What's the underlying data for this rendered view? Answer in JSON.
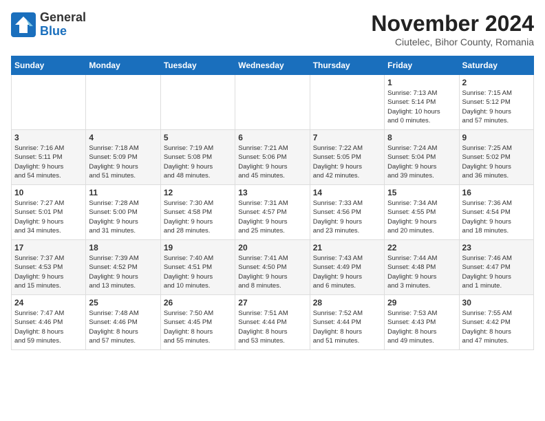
{
  "header": {
    "logo_line1": "General",
    "logo_line2": "Blue",
    "title": "November 2024",
    "subtitle": "Ciutelec, Bihor County, Romania"
  },
  "weekdays": [
    "Sunday",
    "Monday",
    "Tuesday",
    "Wednesday",
    "Thursday",
    "Friday",
    "Saturday"
  ],
  "weeks": [
    [
      {
        "day": "",
        "info": ""
      },
      {
        "day": "",
        "info": ""
      },
      {
        "day": "",
        "info": ""
      },
      {
        "day": "",
        "info": ""
      },
      {
        "day": "",
        "info": ""
      },
      {
        "day": "1",
        "info": "Sunrise: 7:13 AM\nSunset: 5:14 PM\nDaylight: 10 hours\nand 0 minutes."
      },
      {
        "day": "2",
        "info": "Sunrise: 7:15 AM\nSunset: 5:12 PM\nDaylight: 9 hours\nand 57 minutes."
      }
    ],
    [
      {
        "day": "3",
        "info": "Sunrise: 7:16 AM\nSunset: 5:11 PM\nDaylight: 9 hours\nand 54 minutes."
      },
      {
        "day": "4",
        "info": "Sunrise: 7:18 AM\nSunset: 5:09 PM\nDaylight: 9 hours\nand 51 minutes."
      },
      {
        "day": "5",
        "info": "Sunrise: 7:19 AM\nSunset: 5:08 PM\nDaylight: 9 hours\nand 48 minutes."
      },
      {
        "day": "6",
        "info": "Sunrise: 7:21 AM\nSunset: 5:06 PM\nDaylight: 9 hours\nand 45 minutes."
      },
      {
        "day": "7",
        "info": "Sunrise: 7:22 AM\nSunset: 5:05 PM\nDaylight: 9 hours\nand 42 minutes."
      },
      {
        "day": "8",
        "info": "Sunrise: 7:24 AM\nSunset: 5:04 PM\nDaylight: 9 hours\nand 39 minutes."
      },
      {
        "day": "9",
        "info": "Sunrise: 7:25 AM\nSunset: 5:02 PM\nDaylight: 9 hours\nand 36 minutes."
      }
    ],
    [
      {
        "day": "10",
        "info": "Sunrise: 7:27 AM\nSunset: 5:01 PM\nDaylight: 9 hours\nand 34 minutes."
      },
      {
        "day": "11",
        "info": "Sunrise: 7:28 AM\nSunset: 5:00 PM\nDaylight: 9 hours\nand 31 minutes."
      },
      {
        "day": "12",
        "info": "Sunrise: 7:30 AM\nSunset: 4:58 PM\nDaylight: 9 hours\nand 28 minutes."
      },
      {
        "day": "13",
        "info": "Sunrise: 7:31 AM\nSunset: 4:57 PM\nDaylight: 9 hours\nand 25 minutes."
      },
      {
        "day": "14",
        "info": "Sunrise: 7:33 AM\nSunset: 4:56 PM\nDaylight: 9 hours\nand 23 minutes."
      },
      {
        "day": "15",
        "info": "Sunrise: 7:34 AM\nSunset: 4:55 PM\nDaylight: 9 hours\nand 20 minutes."
      },
      {
        "day": "16",
        "info": "Sunrise: 7:36 AM\nSunset: 4:54 PM\nDaylight: 9 hours\nand 18 minutes."
      }
    ],
    [
      {
        "day": "17",
        "info": "Sunrise: 7:37 AM\nSunset: 4:53 PM\nDaylight: 9 hours\nand 15 minutes."
      },
      {
        "day": "18",
        "info": "Sunrise: 7:39 AM\nSunset: 4:52 PM\nDaylight: 9 hours\nand 13 minutes."
      },
      {
        "day": "19",
        "info": "Sunrise: 7:40 AM\nSunset: 4:51 PM\nDaylight: 9 hours\nand 10 minutes."
      },
      {
        "day": "20",
        "info": "Sunrise: 7:41 AM\nSunset: 4:50 PM\nDaylight: 9 hours\nand 8 minutes."
      },
      {
        "day": "21",
        "info": "Sunrise: 7:43 AM\nSunset: 4:49 PM\nDaylight: 9 hours\nand 6 minutes."
      },
      {
        "day": "22",
        "info": "Sunrise: 7:44 AM\nSunset: 4:48 PM\nDaylight: 9 hours\nand 3 minutes."
      },
      {
        "day": "23",
        "info": "Sunrise: 7:46 AM\nSunset: 4:47 PM\nDaylight: 9 hours\nand 1 minute."
      }
    ],
    [
      {
        "day": "24",
        "info": "Sunrise: 7:47 AM\nSunset: 4:46 PM\nDaylight: 8 hours\nand 59 minutes."
      },
      {
        "day": "25",
        "info": "Sunrise: 7:48 AM\nSunset: 4:46 PM\nDaylight: 8 hours\nand 57 minutes."
      },
      {
        "day": "26",
        "info": "Sunrise: 7:50 AM\nSunset: 4:45 PM\nDaylight: 8 hours\nand 55 minutes."
      },
      {
        "day": "27",
        "info": "Sunrise: 7:51 AM\nSunset: 4:44 PM\nDaylight: 8 hours\nand 53 minutes."
      },
      {
        "day": "28",
        "info": "Sunrise: 7:52 AM\nSunset: 4:44 PM\nDaylight: 8 hours\nand 51 minutes."
      },
      {
        "day": "29",
        "info": "Sunrise: 7:53 AM\nSunset: 4:43 PM\nDaylight: 8 hours\nand 49 minutes."
      },
      {
        "day": "30",
        "info": "Sunrise: 7:55 AM\nSunset: 4:42 PM\nDaylight: 8 hours\nand 47 minutes."
      }
    ]
  ]
}
